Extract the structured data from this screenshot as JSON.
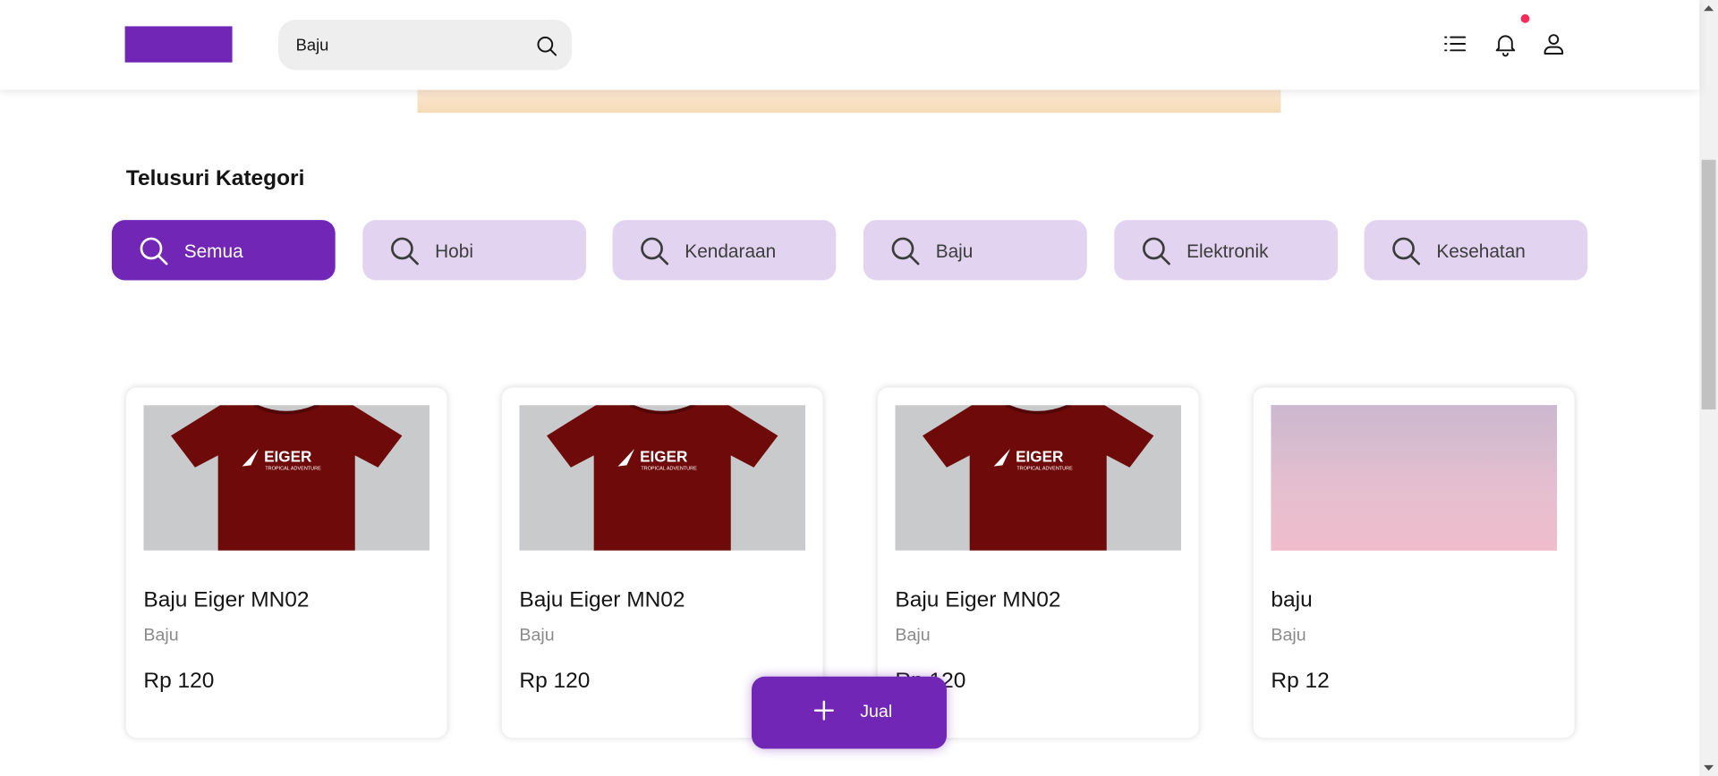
{
  "header": {
    "search": {
      "value": "Baju",
      "icon": "search-icon"
    },
    "icons": [
      "list-icon",
      "bell-icon",
      "user-icon"
    ],
    "notification_dot_color": "#fa2c5a"
  },
  "categories": {
    "title": "Telusuri Kategori",
    "items": [
      {
        "label": "Semua",
        "active": true
      },
      {
        "label": "Hobi",
        "active": false
      },
      {
        "label": "Kendaraan",
        "active": false
      },
      {
        "label": "Baju",
        "active": false
      },
      {
        "label": "Elektronik",
        "active": false
      },
      {
        "label": "Kesehatan",
        "active": false
      }
    ]
  },
  "products": [
    {
      "name": "Baju Eiger MN02",
      "category": "Baju",
      "price": "Rp 120",
      "image": "red-eiger-tshirt",
      "image_brand": "EIGER",
      "image_tagline": "TROPICAL ADVENTURE"
    },
    {
      "name": "Baju Eiger MN02",
      "category": "Baju",
      "price": "Rp 120",
      "image": "red-eiger-tshirt",
      "image_brand": "EIGER",
      "image_tagline": "TROPICAL ADVENTURE"
    },
    {
      "name": "Baju Eiger MN02",
      "category": "Baju",
      "price": "Rp 120",
      "image": "red-eiger-tshirt",
      "image_brand": "EIGER",
      "image_tagline": "TROPICAL ADVENTURE"
    },
    {
      "name": "baju",
      "category": "Baju",
      "price": "Rp 12",
      "image": "pink-gradient"
    }
  ],
  "sell_button": {
    "label": "Jual",
    "icon": "plus-icon"
  },
  "colors": {
    "primary": "#7126b5",
    "category_bg": "#e2d4f0",
    "secondary_text": "#8a8a8a"
  }
}
